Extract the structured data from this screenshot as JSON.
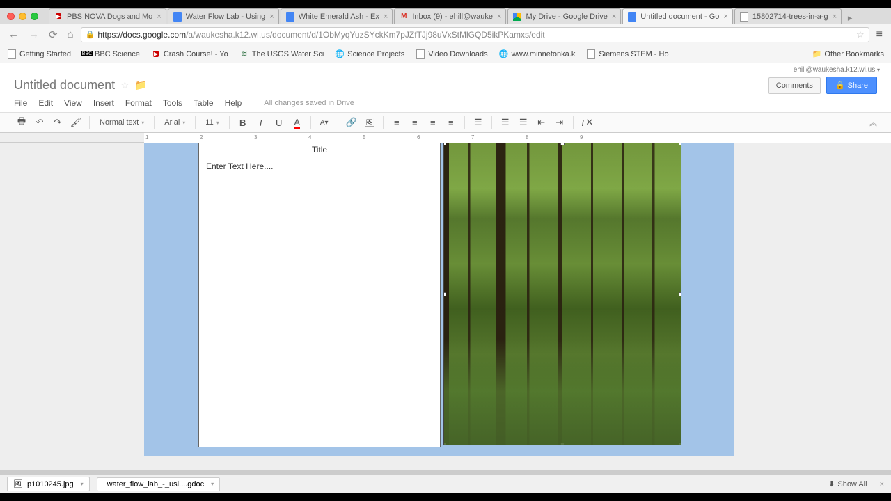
{
  "browser_tabs": [
    {
      "label": "PBS NOVA Dogs and Mo",
      "icon": "youtube"
    },
    {
      "label": "Water Flow Lab - Using",
      "icon": "gdoc"
    },
    {
      "label": "White Emerald Ash - Ex",
      "icon": "gdoc"
    },
    {
      "label": "Inbox (9) - ehill@wauke",
      "icon": "gmail"
    },
    {
      "label": "My Drive - Google Drive",
      "icon": "gdrive"
    },
    {
      "label": "Untitled document - Go",
      "icon": "gdoc",
      "active": true
    },
    {
      "label": "15802714-trees-in-a-g",
      "icon": "page"
    }
  ],
  "url": {
    "host": "https://docs.google.com",
    "path": "/a/waukesha.k12.wi.us/document/d/1ObMyqYuzSYckKm7pJZfTJj98uVxStMlGQD5ikPKamxs/edit"
  },
  "bookmarks": [
    {
      "label": "Getting Started",
      "icon": "page"
    },
    {
      "label": "BBC Science",
      "icon": "bbc"
    },
    {
      "label": "Crash Course! - Yo",
      "icon": "youtube"
    },
    {
      "label": "The USGS Water Sci",
      "icon": "usgs"
    },
    {
      "label": "Science Projects",
      "icon": "globe"
    },
    {
      "label": "Video Downloads",
      "icon": "page"
    },
    {
      "label": "www.minnetonka.k",
      "icon": "globe"
    },
    {
      "label": "Siemens STEM - Ho",
      "icon": "page"
    }
  ],
  "other_bookmarks_label": "Other Bookmarks",
  "user_email": "ehill@waukesha.k12.wi.us",
  "doc": {
    "title": "Untitled document",
    "save_msg": "All changes saved in Drive"
  },
  "menus": [
    "File",
    "Edit",
    "View",
    "Insert",
    "Format",
    "Tools",
    "Table",
    "Help"
  ],
  "header_buttons": {
    "comments": "Comments",
    "share": "Share"
  },
  "toolbar": {
    "style": "Normal text",
    "font": "Arial",
    "size": "11"
  },
  "ruler_ticks": [
    "1",
    "2",
    "3",
    "4",
    "5",
    "6",
    "7",
    "8",
    "9"
  ],
  "document_content": {
    "title": "Title",
    "body": "Enter Text Here...."
  },
  "downloads": [
    {
      "label": "p1010245.jpg",
      "icon": "img"
    },
    {
      "label": "water_flow_lab_-_usi....gdoc",
      "icon": "gdoc"
    }
  ],
  "show_all_label": "Show All"
}
